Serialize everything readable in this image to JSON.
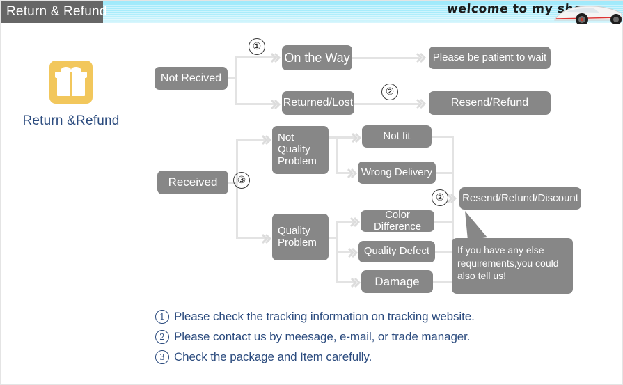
{
  "header": {
    "tab_label": "Return & Refund",
    "welcome_text": "welcome to my shop",
    "band_color": "#a9ecfb",
    "tab_color": "#666666",
    "car_icon": "sports-car-icon"
  },
  "brand": {
    "icon": "gift-box-icon",
    "icon_color": "#f2c75c",
    "label": "Return &Refund",
    "label_color": "#2b4b7e"
  },
  "flow": {
    "node_color": "#878787",
    "connector_color": "#e3e3e3",
    "nodes": {
      "not_recived": "Not Recived",
      "on_the_way": "On the Way",
      "returned_lost": "Returned/Lost",
      "please_wait": "Please be patient to wait",
      "resend_refund": "Resend/Refund",
      "received": "Received",
      "not_quality_problem": "Not\nQuality\nProblem",
      "quality_problem": "Quality\nProblem",
      "not_fit": "Not fit",
      "wrong_delivery": "Wrong Delivery",
      "color_difference": "Color Difference",
      "quality_defect": "Quality Defect",
      "damage": "Damage",
      "resend_refund_discount": "Resend/Refund/Discount"
    },
    "callout": "If you have any else requirements,you could also tell us!",
    "markers": {
      "m1": "①",
      "m2a": "②",
      "m3": "③",
      "m2b": "②"
    }
  },
  "footnotes": [
    {
      "num": "1",
      "text": "Please check the tracking information on tracking website."
    },
    {
      "num": "2",
      "text": "Please contact us by meesage, e-mail, or trade manager."
    },
    {
      "num": "3",
      "text": "Check the package and Item carefully."
    }
  ]
}
